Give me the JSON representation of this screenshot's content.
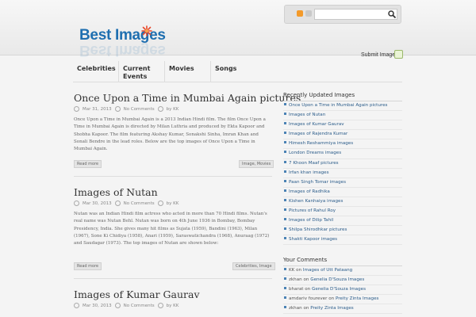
{
  "header": {
    "logo_text": "Best Images",
    "search_placeholder": "",
    "submit_label": "Submit Images"
  },
  "nav": {
    "items": [
      {
        "label": "Celebrities"
      },
      {
        "label": "Current Events"
      },
      {
        "label": "Movies"
      },
      {
        "label": "Songs"
      }
    ]
  },
  "posts": [
    {
      "title": "Once Upon a Time in Mumbai Again pictures",
      "date": "Mar 31, 2013",
      "comments": "No Comments",
      "author": "by KK",
      "excerpt": "Once Upon a Time in Mumbai Again is a 2013 Indian Hindi film. The film Once Upon a Time in Mumbai Again is directed by Milan Luthria and produced by Ekta Kapoor and Shobha Kapoor. The film featuring Akshay Kumar, Sonakshi Sinha, Imran Khan and Sonali Bendre in the lead roles. Below are the top images of Once Upon a Time in Mumbai Again.",
      "readmore": "Read more",
      "tags": "Image, Movies"
    },
    {
      "title": "Images of Nutan",
      "date": "Mar 30, 2013",
      "comments": "No Comments",
      "author": "by KK",
      "excerpt": "Nutan was an Indian Hindi film actress who acted in more than 70 Hindi films. Nutan's real name was Nutan Behl. Nutan was born on 4th June 1936 in Bombay, Bombay Presidency, India. She gives many hit films as Sujata (1959), Bandini (1963), Milan (1967), Sone Ki Chidiya (1958), Anari (1959), Saraswatichandra (1968), Anuraag (1972) and Saudagar (1973). The top images of Nutan are shown below:",
      "readmore": "Read more",
      "tags": "Celebrities, Image"
    },
    {
      "title": "Images of Kumar Gaurav",
      "date": "Mar 30, 2013",
      "comments": "No Comments",
      "author": "by KK"
    }
  ],
  "sidebar": {
    "recent_heading": "Recently Updated Images",
    "recent_items": [
      "Once Upon a Time in Mumbai Again pictures",
      "Images of Nutan",
      "Images of Kumar Gaurav",
      "Images of Rajendra Kumar",
      "Himesh Reshammiya images",
      "London Dreams images",
      "7 Khoon Maaf pictures",
      "Irfan khan images",
      "Paan Singh Tomar images",
      "Images of Radhika",
      "Kishen Kanhaiya images",
      "Pictures of Rahul Roy",
      "Images of Dilip Tahil",
      "Shilpa Shirodhkar pictures",
      "Shakti Kapoor images"
    ],
    "comments_heading": "Your Comments",
    "comments": [
      {
        "who": "KK",
        "on": "on",
        "link": "Images of Utt Pataang"
      },
      {
        "who": "zkhan",
        "on": "on",
        "link": "Genelia D'Souza Images"
      },
      {
        "who": "bharat",
        "on": "on",
        "link": "Genelia D'Souza Images"
      },
      {
        "who": "amdariv fourever",
        "on": "on",
        "link": "Preity Zinta Images"
      },
      {
        "who": "zkhan",
        "on": "on",
        "link": "Preity Zinta Images"
      }
    ]
  },
  "colors": {
    "logo": "#1f6fb0",
    "link": "#2b5c8a",
    "rss": "#f39a2a"
  }
}
